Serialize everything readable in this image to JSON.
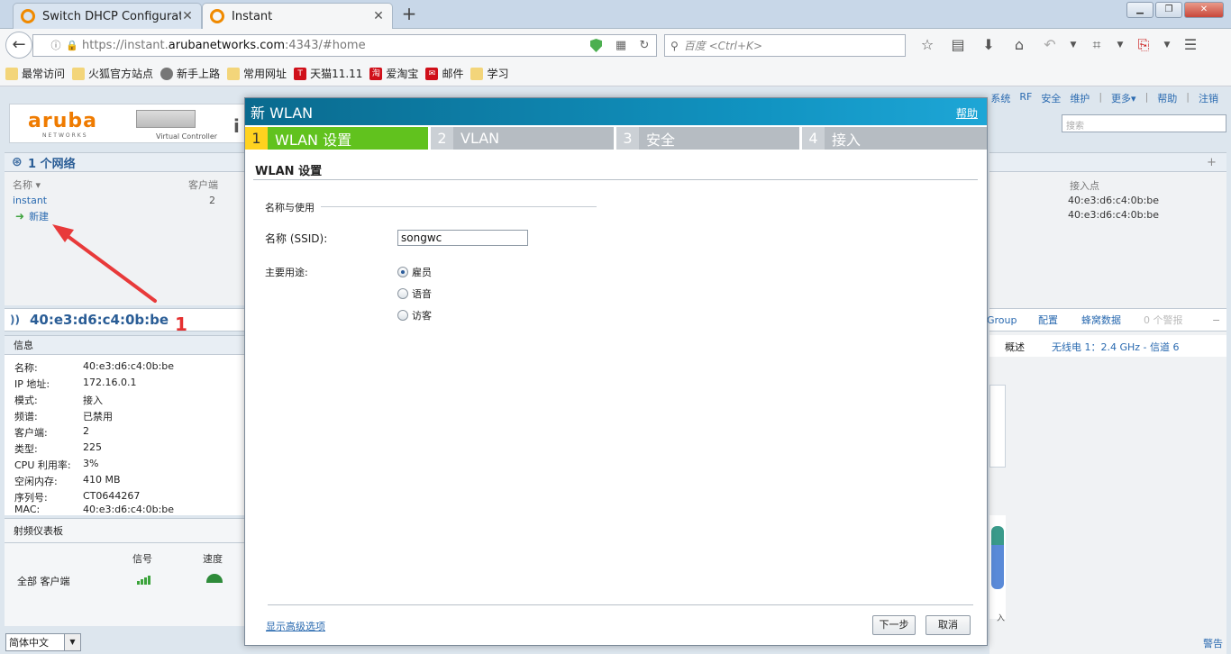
{
  "browser": {
    "tabs": [
      {
        "title": "Switch DHCP Configurati...",
        "active": false
      },
      {
        "title": "Instant",
        "active": true
      }
    ],
    "url_prefix": "https://instant.",
    "url_domain": "arubanetworks.com",
    "url_suffix": ":4343/#home",
    "search_placeholder": "百度 <Ctrl+K>",
    "bookmarks": [
      "最常访问",
      "火狐官方站点",
      "新手上路",
      "常用网址",
      "天猫11.11",
      "爱淘宝",
      "邮件",
      "学习"
    ]
  },
  "aruba": {
    "top_nav": [
      "系统",
      "RF",
      "安全",
      "维护",
      "更多▾",
      "帮助",
      "注销"
    ],
    "search_placeholder": "搜索",
    "logo": "aruba",
    "logo_sub": "NETWORKS",
    "vc_label": "Virtual Controller",
    "networks": {
      "title": "1 个网络",
      "col_name": "名称 ▾",
      "col_clients": "客户端",
      "items": [
        {
          "name": "instant",
          "clients": "2"
        }
      ],
      "new_label": "新建"
    },
    "annotation_number": "1",
    "ap_title": "40:e3:d6:c4:0b:be",
    "info": {
      "title": "信息",
      "rows": [
        {
          "k": "名称:",
          "v": "40:e3:d6:c4:0b:be"
        },
        {
          "k": "IP 地址:",
          "v": "172.16.0.1"
        },
        {
          "k": "模式:",
          "v": "接入"
        },
        {
          "k": "频谱:",
          "v": "已禁用"
        },
        {
          "k": "客户端:",
          "v": "2"
        },
        {
          "k": "类型:",
          "v": "225"
        },
        {
          "k": "CPU 利用率:",
          "v": "3%"
        },
        {
          "k": "空闲内存:",
          "v": "410 MB"
        },
        {
          "k": "序列号:",
          "v": "CT0644267"
        },
        {
          "k": "MAC:",
          "v": "40:e3:d6:c4:0b:be"
        }
      ]
    },
    "rf": {
      "title": "射频仪表板",
      "col_signal": "信号",
      "col_speed": "速度",
      "row_label": "全部 客户端"
    },
    "right": {
      "col_ap": "接入点",
      "macs": [
        "40:e3:d6:c4:0b:be",
        "40:e3:d6:c4:0b:be"
      ],
      "bar_group": "Group",
      "bar_config": "配置",
      "bar_cellular": "蜂窝数据",
      "bar_alerts": "0 个警报",
      "tab_overview": "概述",
      "tab_radio": "无线电 1：2.4 GHz - 信道 6",
      "chart_in": "入"
    },
    "lang": "简体中文",
    "alerts_link": "警告"
  },
  "modal": {
    "title": "新 WLAN",
    "help": "帮助",
    "steps": [
      {
        "num": "1",
        "label": "WLAN 设置"
      },
      {
        "num": "2",
        "label": "VLAN"
      },
      {
        "num": "3",
        "label": "安全"
      },
      {
        "num": "4",
        "label": "接入"
      }
    ],
    "section_title": "WLAN 设置",
    "group_label": "名称与使用",
    "ssid_label": "名称 (SSID):",
    "ssid_value": "songwc",
    "use_label": "主要用途:",
    "use_options": [
      "雇员",
      "语音",
      "访客"
    ],
    "use_selected": "雇员",
    "advanced_link": "显示高级选项",
    "next_button": "下一步",
    "cancel_button": "取消"
  }
}
